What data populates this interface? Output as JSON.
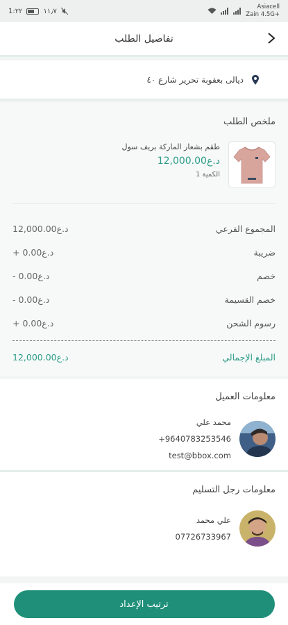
{
  "status_bar": {
    "time": "1:۲۲",
    "speed": "۱۱٫۷",
    "carrier_line1": "Asiacell",
    "carrier_line2": "Zain 4.5G+"
  },
  "header": {
    "title": "تفاصيل الطلب"
  },
  "address": {
    "text": "ديالى بعقوبة تحرير شارع ٤٠"
  },
  "summary": {
    "title": "ملخص الطلب",
    "product": {
      "name": "طقم بشعار الماركة بريف سول",
      "price": "د.ع12,000.00",
      "quantity": "الكمية 1"
    },
    "rows": [
      {
        "label": "المجموع الفرعي",
        "value": "د.ع12,000.00"
      },
      {
        "label": "ضريبة",
        "value": "+ د.ع0.00"
      },
      {
        "label": "خصم",
        "value": "- د.ع0.00"
      },
      {
        "label": "خصم القسيمة",
        "value": "- د.ع0.00"
      },
      {
        "label": "رسوم الشحن",
        "value": "+ د.ع0.00"
      }
    ],
    "total": {
      "label": "المبلغ الإجمالي",
      "value": "د.ع12,000.00"
    }
  },
  "customer": {
    "title": "معلومات العميل",
    "name": "محمد علي",
    "phone": "+9640783253546",
    "email": "test@bbox.com"
  },
  "delivery": {
    "title": "معلومات رجل التسليم",
    "name": "علي محمد",
    "phone": "07726733967"
  },
  "cta": {
    "label": "ترتيب الإعداد"
  },
  "colors": {
    "accent": "#1f8f79",
    "price": "#2b9b86"
  }
}
